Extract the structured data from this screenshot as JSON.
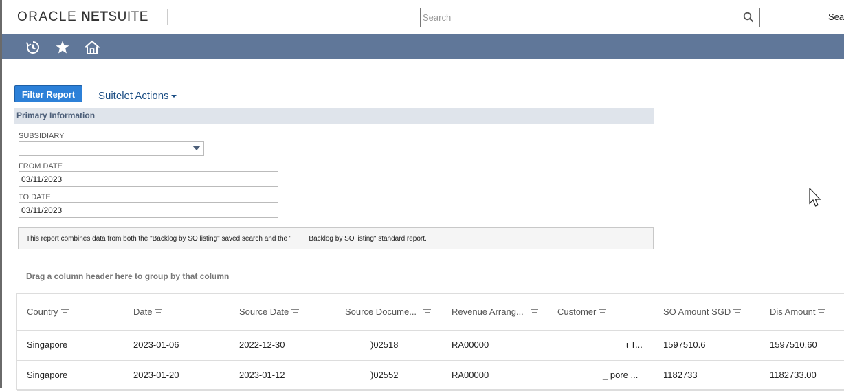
{
  "header": {
    "logo": {
      "oracle": "ORACLE",
      "net": "NET",
      "suite": "SUITE"
    },
    "search": {
      "placeholder": "Search",
      "icon": "search-icon"
    },
    "right_text": "Sear"
  },
  "navbar": {
    "icons": [
      "recent-records-icon",
      "star-icon",
      "home-icon"
    ]
  },
  "actions": {
    "filter_button": "Filter Report",
    "suitelet_actions": "Suitelet Actions"
  },
  "primary_info": {
    "title": "Primary Information",
    "subsidiary": {
      "label": "SUBSIDIARY",
      "value": ""
    },
    "from_date": {
      "label": "FROM DATE",
      "value": "03/11/2023"
    },
    "to_date": {
      "label": "TO DATE",
      "value": "03/11/2023"
    }
  },
  "note": "This report combines data from both the \"Backlog by SO listing\" saved search and the \"         Backlog by SO listing\" standard report.",
  "grid": {
    "group_hint": "Drag a column header here to group by that column",
    "columns": [
      "Country",
      "Date",
      "Source Date",
      "Source Docume...",
      "Revenue Arrang...",
      "Customer",
      "SO Amount SGD",
      "Dis Amount"
    ],
    "rows": [
      [
        "Singapore",
        "2023-01-06",
        "2022-12-30",
        ")02518",
        "RA00000",
        "ι T...",
        "1597510.6",
        "1597510.60"
      ],
      [
        "Singapore",
        "2023-01-20",
        "2023-01-12",
        ")02552",
        "RA00000",
        "_ pore ...",
        "1182733",
        "1182733.00"
      ]
    ]
  },
  "colors": {
    "navbar": "#607799",
    "button": "#2c80d8",
    "section_header": "#dfe4eb",
    "link": "#1d4f85"
  }
}
